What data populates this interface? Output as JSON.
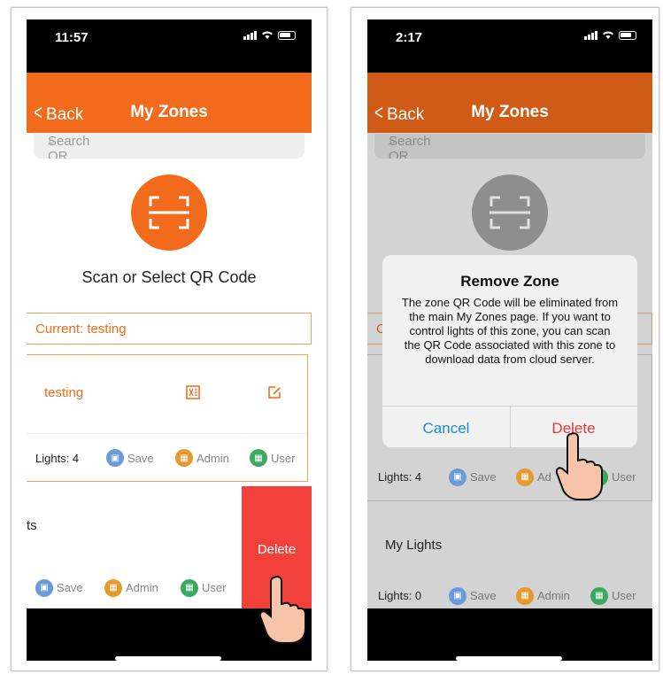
{
  "left": {
    "status": {
      "time": "11:57"
    },
    "nav": {
      "back": "Back",
      "title": "My Zones"
    },
    "search": {
      "placeholder": "Search QR Code name"
    },
    "scan_label": "Scan or Select QR Code",
    "current": "Current: testing",
    "zone_card": {
      "name": "testing",
      "lights": "Lights: 4",
      "save": "Save",
      "admin": "Admin",
      "user": "User"
    },
    "swiped_row": {
      "name_fragment": "ts",
      "save": "Save",
      "admin": "Admin",
      "user": "User",
      "delete": "Delete"
    }
  },
  "right": {
    "status": {
      "time": "2:17"
    },
    "nav": {
      "back": "Back",
      "title": "My Zones"
    },
    "search": {
      "placeholder": "Search QR Code name"
    },
    "current_fragment": "C",
    "zone_card": {
      "lights": "Lights: 4",
      "save": "Save",
      "admin": "Ad",
      "user": "User"
    },
    "second_zone": {
      "name": "My Lights",
      "lights": "Lights: 0",
      "save": "Save",
      "admin": "Admin",
      "user": "User"
    },
    "dialog": {
      "title": "Remove Zone",
      "message": "The zone QR Code will be eliminated from the main My Zones page. If you want to control lights of this zone, you can scan the QR Code associated with this zone to download data from cloud server.",
      "cancel": "Cancel",
      "delete": "Delete"
    }
  },
  "colors": {
    "accent": "#f26b1d",
    "delete_red": "#f2413a",
    "link_blue": "#1a8fd6"
  }
}
